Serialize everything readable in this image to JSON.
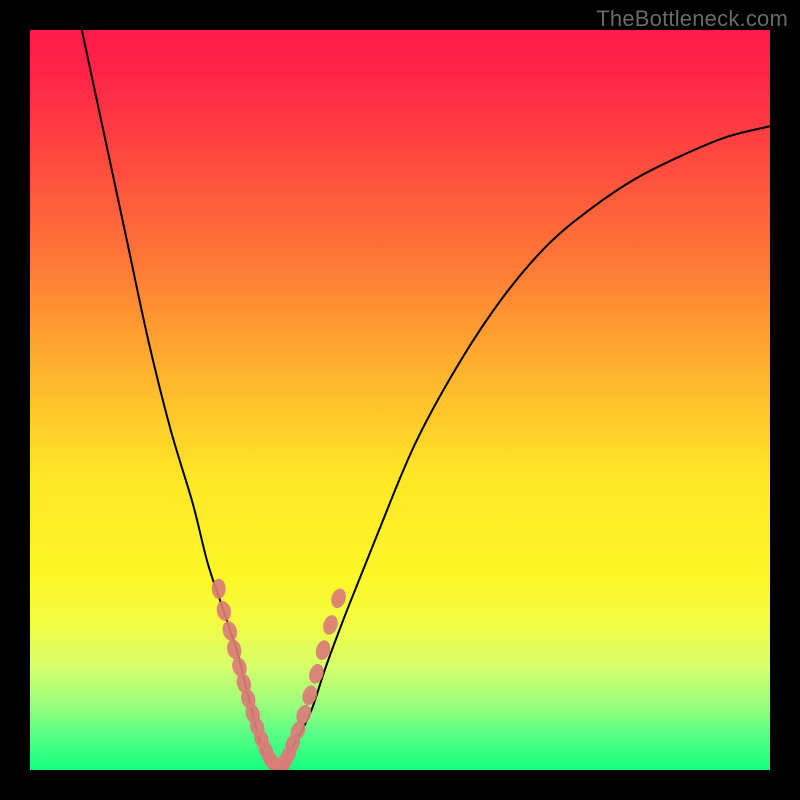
{
  "watermark": {
    "text": "TheBottleneck.com"
  },
  "chart_data": {
    "type": "line",
    "title": "",
    "xlabel": "",
    "ylabel": "",
    "xlim": [
      0,
      100
    ],
    "ylim": [
      0,
      100
    ],
    "series": [
      {
        "name": "bottleneck-curve",
        "x": [
          7,
          10,
          13,
          16,
          19,
          22,
          24,
          26,
          28,
          29,
          30,
          31,
          32,
          33,
          34,
          36,
          38,
          40,
          43,
          47,
          52,
          58,
          64,
          70,
          76,
          82,
          88,
          94,
          100
        ],
        "y": [
          100,
          86,
          72,
          58,
          46,
          36,
          28,
          22,
          16,
          12,
          8,
          4,
          1,
          0,
          1,
          4,
          8,
          14,
          22,
          32,
          44,
          55,
          64,
          71,
          76,
          80,
          83,
          85.5,
          87
        ],
        "color": "#000000",
        "stroke_width": 2
      },
      {
        "name": "highlight-markers",
        "x": [
          25.5,
          26.2,
          27.0,
          27.6,
          28.3,
          28.9,
          29.5,
          30.1,
          30.7,
          31.3,
          31.9,
          32.5,
          33.1,
          33.7,
          34.3,
          34.9,
          35.5,
          36.2,
          37.0,
          37.8,
          38.7,
          39.6,
          40.6,
          41.7
        ],
        "y": [
          24.5,
          21.5,
          18.8,
          16.3,
          13.9,
          11.7,
          9.6,
          7.6,
          5.8,
          4.1,
          2.6,
          1.4,
          0.7,
          0.5,
          1.0,
          2.0,
          3.5,
          5.3,
          7.5,
          10.1,
          13.0,
          16.2,
          19.6,
          23.2
        ],
        "color": "#da7c77",
        "marker_rx": 7,
        "marker_ry": 10
      }
    ],
    "background": {
      "type": "vertical-gradient",
      "stops": [
        {
          "offset": 0.0,
          "color": "#ff1b4a"
        },
        {
          "offset": 0.6,
          "color": "#ffe626"
        },
        {
          "offset": 1.0,
          "color": "#15ff7e"
        }
      ]
    }
  }
}
